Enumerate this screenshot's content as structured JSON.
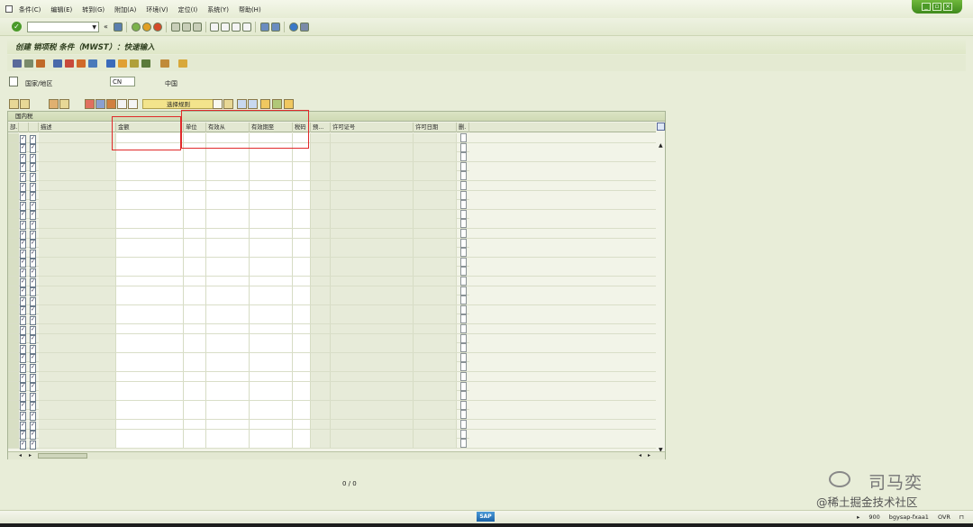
{
  "menu": [
    "条件(C)",
    "编辑(E)",
    "转到(G)",
    "附加(A)",
    "环境(V)",
    "定位(I)",
    "系统(Y)",
    "帮助(H)"
  ],
  "title": "创建 销项税 条件（MWST）：快速输入",
  "country": {
    "label": "国家/地区",
    "code": "CN",
    "name": "中国"
  },
  "grid_toolbar": {
    "variant_button": "选择规则"
  },
  "table": {
    "caption": "国内税",
    "columns": {
      "sel": "部.",
      "c1": "",
      "c2": "",
      "description": "描述",
      "amount": "金额",
      "unit": "单位",
      "valid_from": "有效从",
      "valid_to": "有效期至",
      "tax_code": "税码",
      "withholding": "预...",
      "license_no": "许可证号",
      "license_date": "许可日期",
      "deleted": "删."
    },
    "row_count": 33
  },
  "page_indicator": "0 / 0",
  "watermark": {
    "name": "司马奕",
    "site": "@稀土掘金技术社区"
  },
  "status": {
    "client": "900",
    "server": "bgysap-fxaa1",
    "mode": "OVR"
  },
  "sap_logo": "SAP"
}
